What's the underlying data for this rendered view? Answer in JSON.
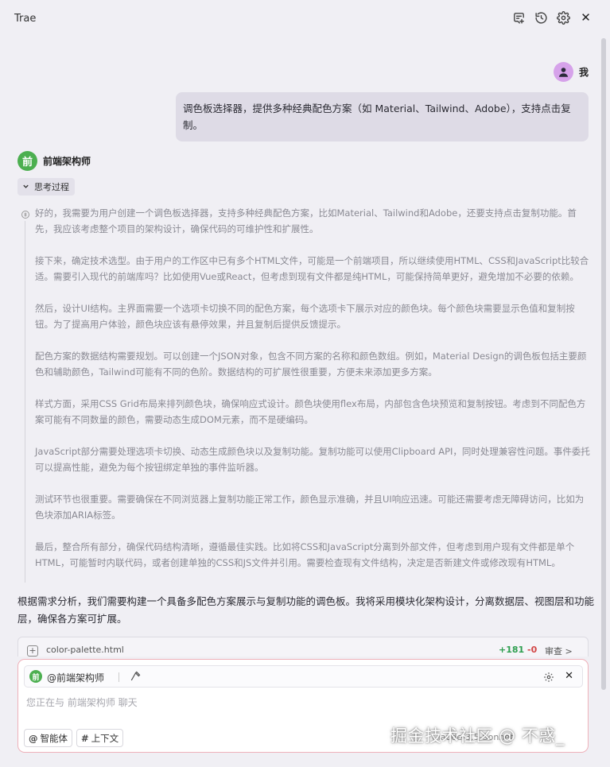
{
  "app": {
    "title": "Trae"
  },
  "user": {
    "name": "我",
    "message": "调色板选择器，提供多种经典配色方案（如 Material、Tailwind、Adobe），支持点击复制。"
  },
  "assistant": {
    "name": "前端架构师",
    "avatar_text": "前",
    "accent": "#4caf50"
  },
  "thinking": {
    "toggle_label": "思考过程",
    "paragraphs": [
      "好的，我需要为用户创建一个调色板选择器，支持多种经典配色方案，比如Material、Tailwind和Adobe，还要支持点击复制功能。首先，我应该考虑整个项目的架构设计，确保代码的可维护性和扩展性。",
      "接下来，确定技术选型。由于用户的工作区中已有多个HTML文件，可能是一个前端项目，所以继续使用HTML、CSS和JavaScript比较合适。需要引入现代的前端库吗？比如使用Vue或React，但考虑到现有文件都是纯HTML，可能保持简单更好，避免增加不必要的依赖。",
      "然后，设计UI结构。主界面需要一个选项卡切换不同的配色方案，每个选项卡下展示对应的颜色块。每个颜色块需要显示色值和复制按钮。为了提高用户体验，颜色块应该有悬停效果，并且复制后提供反馈提示。",
      "配色方案的数据结构需要规划。可以创建一个JSON对象，包含不同方案的名称和颜色数组。例如，Material Design的调色板包括主要颜色和辅助颜色，Tailwind可能有不同的色阶。数据结构的可扩展性很重要，方便未来添加更多方案。",
      "样式方面，采用CSS Grid布局来排列颜色块，确保响应式设计。颜色块使用flex布局，内部包含色块预览和复制按钮。考虑到不同配色方案可能有不同数量的颜色，需要动态生成DOM元素，而不是硬编码。",
      "JavaScript部分需要处理选项卡切换、动态生成颜色块以及复制功能。复制功能可以使用Clipboard API，同时处理兼容性问题。事件委托可以提高性能，避免为每个按钮绑定单独的事件监听器。",
      "测试环节也很重要。需要确保在不同浏览器上复制功能正常工作，颜色显示准确，并且UI响应迅速。可能还需要考虑无障碍访问，比如为色块添加ARIA标签。",
      "最后，整合所有部分，确保代码结构清晰，遵循最佳实践。比如将CSS和JavaScript分离到外部文件，但考虑到用户现有文件都是单个HTML，可能暂时内联代码，或者创建单独的CSS和JS文件并引用。需要检查现有文件结构，决定是否新建文件或修改现有HTML。"
    ]
  },
  "summary": "根据需求分析，我们需要构建一个具备多配色方案展示与复制功能的调色板。我将采用模块化架构设计，分离数据层、视图层和功能层，确保各方案可扩展。",
  "file_card": {
    "filename": "color-palette.html",
    "additions": "+181",
    "deletions": "-0",
    "review_label": "审查 >"
  },
  "composer": {
    "agent_label": "@前端架构师",
    "agent_badge": "前",
    "placeholder": "您正在与 前端架构师 聊天",
    "chip_agent_symbol": "@",
    "chip_agent_label": "智能体",
    "chip_context_symbol": "#",
    "chip_context_label": "上下文",
    "right_hint": "Claude-3.5-Sonnet"
  },
  "watermark": "掘金技术社区 @ 不惑_"
}
